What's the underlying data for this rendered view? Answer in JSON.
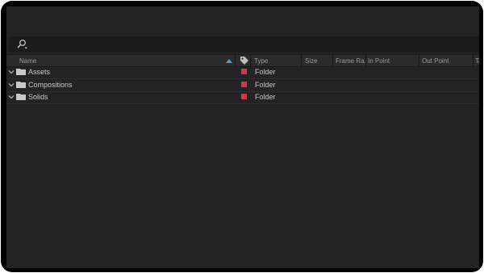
{
  "search": {
    "placeholder": "",
    "value": ""
  },
  "columns": {
    "name": "Name",
    "type": "Type",
    "size": "Size",
    "frame_rate": "Frame Ra...",
    "in_point": "In Point",
    "out_point": "Out Point",
    "tape": "Ta"
  },
  "items": [
    {
      "name": "Assets",
      "type": "Folder",
      "label_color": "#e0304d"
    },
    {
      "name": "Compositions",
      "type": "Folder",
      "label_color": "#e0304d"
    },
    {
      "name": "Solids",
      "type": "Folder",
      "label_color": "#e0304d"
    }
  ],
  "icons": {
    "search": "search-icon",
    "sort": "sort-ascending-icon",
    "label": "tag-icon",
    "expand": "chevron-down-icon",
    "folder": "folder-icon"
  }
}
